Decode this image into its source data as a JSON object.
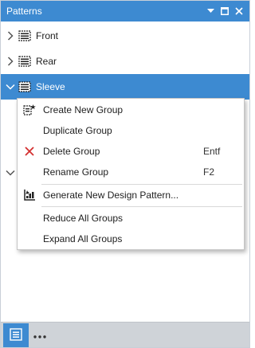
{
  "panel": {
    "title": "Patterns",
    "icons": [
      "dropdown-arrow-icon",
      "maximize-icon",
      "close-icon"
    ]
  },
  "tree": {
    "items": [
      {
        "label": "Front",
        "expanded": false,
        "selected": false
      },
      {
        "label": "Rear",
        "expanded": false,
        "selected": false
      },
      {
        "label": "Sleeve",
        "expanded": true,
        "selected": true
      }
    ]
  },
  "context_menu": {
    "items": [
      {
        "label": "Create New Group",
        "icon": "create-group-icon",
        "shortcut": ""
      },
      {
        "label": "Duplicate Group",
        "icon": "",
        "shortcut": ""
      },
      {
        "label": "Delete Group",
        "icon": "delete-x-icon",
        "shortcut": "Entf"
      },
      {
        "label": "Rename Group",
        "icon": "",
        "shortcut": "F2"
      },
      {
        "label": "Generate New Design Pattern...",
        "icon": "generate-pattern-icon",
        "shortcut": ""
      },
      {
        "label": "Reduce All Groups",
        "icon": "",
        "shortcut": ""
      },
      {
        "label": "Expand All Groups",
        "icon": "",
        "shortcut": ""
      }
    ]
  },
  "bottom_bar": {
    "icons": [
      "list-view-icon",
      "more-options-icon"
    ]
  },
  "colors": {
    "accent": "#3d8ad1",
    "delete_red": "#d32f2f",
    "bottom_bar_bg": "#cfd3d8"
  }
}
